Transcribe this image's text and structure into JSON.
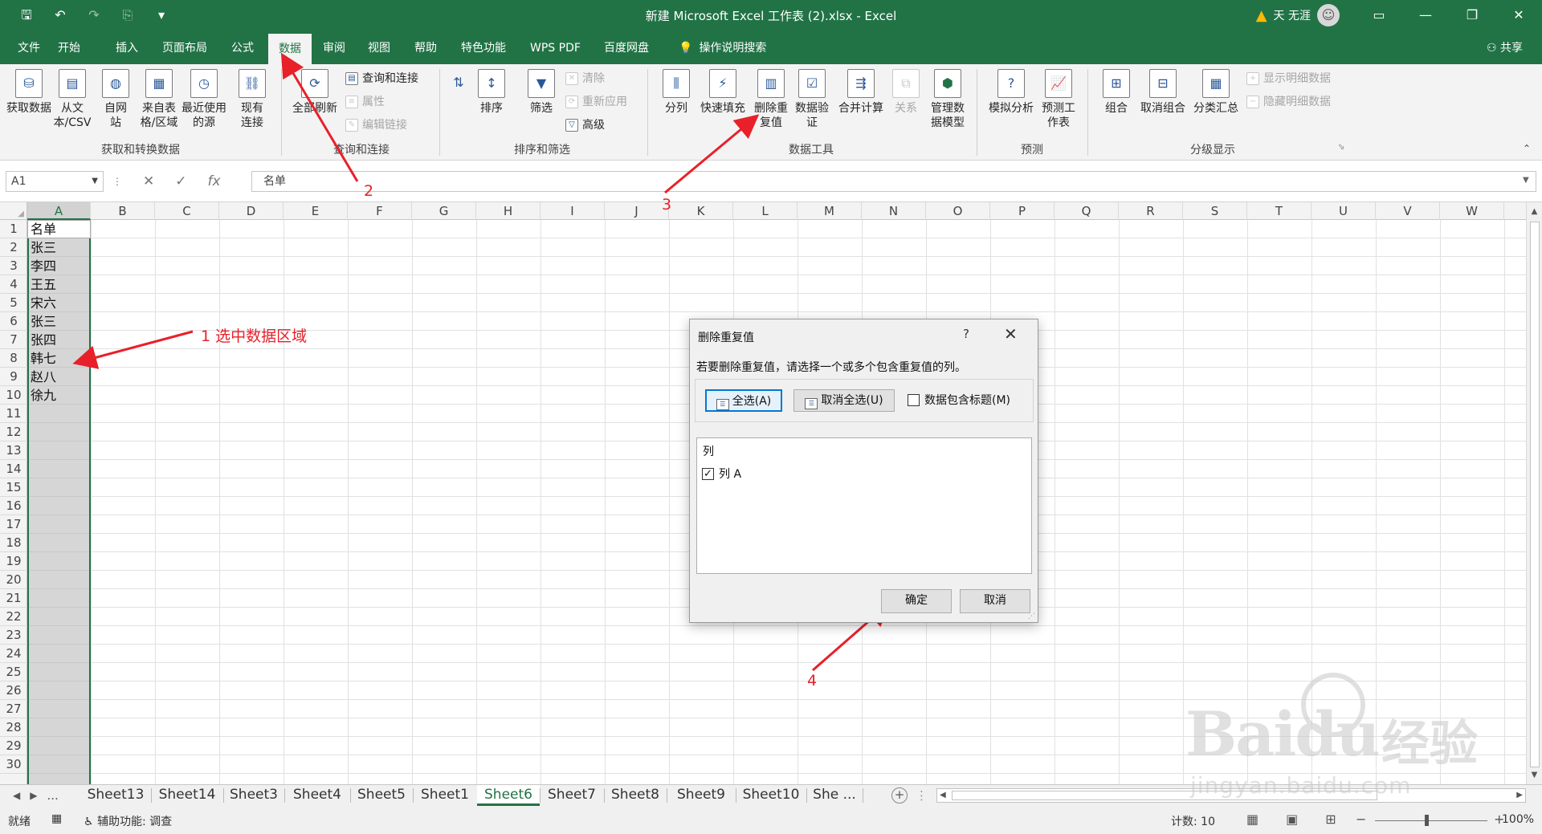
{
  "titlebar": {
    "title": "新建 Microsoft Excel 工作表 (2).xlsx - Excel",
    "user": "天 无涯",
    "save_icon": "save-icon",
    "accent": "#217346"
  },
  "menu_tabs": [
    "文件",
    "开始",
    "插入",
    "页面布局",
    "公式",
    "数据",
    "审阅",
    "视图",
    "帮助",
    "特色功能",
    "WPS PDF",
    "百度网盘"
  ],
  "tell_me": "操作说明搜索",
  "share": "共享",
  "ribbon": {
    "get_data": "获取数据",
    "from_csv": "从文本/CSV",
    "from_web": "自网站",
    "from_table": "来自表格/区域",
    "recent_sources": "最近使用的源",
    "existing_conn": "现有连接",
    "group_get": "获取和转换数据",
    "refresh_all": "全部刷新",
    "queries_conn": "查询和连接",
    "properties": "属性",
    "edit_links": "编辑链接",
    "group_query": "查询和连接",
    "sort": "排序",
    "filter": "筛选",
    "clear": "清除",
    "reapply": "重新应用",
    "advanced": "高级",
    "group_sort": "排序和筛选",
    "text_to_cols": "分列",
    "flash_fill": "快速填充",
    "remove_dup": "删除重复值",
    "data_valid": "数据验证",
    "consolidate": "合并计算",
    "relations": "关系",
    "data_model": "管理数据模型",
    "group_tools": "数据工具",
    "whatif": "模拟分析",
    "forecast": "预测工作表",
    "group_forecast": "预测",
    "group_btn": "组合",
    "ungroup": "取消组合",
    "subtotal": "分类汇总",
    "show_detail": "显示明细数据",
    "hide_detail": "隐藏明细数据",
    "group_outline": "分级显示"
  },
  "formula": {
    "name_box": "A1",
    "content": "名单",
    "fx": "fx"
  },
  "columns": [
    "A",
    "B",
    "C",
    "D",
    "E",
    "F",
    "G",
    "H",
    "I",
    "J",
    "K",
    "L",
    "M",
    "N",
    "O",
    "P",
    "Q",
    "R",
    "S",
    "T",
    "U",
    "V",
    "W"
  ],
  "rows": [
    "1",
    "2",
    "3",
    "4",
    "5",
    "6",
    "7",
    "8",
    "9",
    "10",
    "11",
    "12",
    "13",
    "14",
    "15",
    "16",
    "17",
    "18",
    "19",
    "20",
    "21",
    "22",
    "23",
    "24",
    "25",
    "26",
    "27",
    "28",
    "29",
    "30"
  ],
  "cells_a": [
    "名单",
    "张三",
    "李四",
    "王五",
    "宋六",
    "张三",
    "张四",
    "韩七",
    "赵八",
    "徐九"
  ],
  "annotations": {
    "a1": "1 选中数据区域",
    "a2": "2",
    "a3": "3",
    "a4": "4",
    "color": "#e8202a"
  },
  "dialog": {
    "title": "删除重复值",
    "help": "?",
    "desc": "若要删除重复值，请选择一个或多个包含重复值的列。",
    "select_all": "全选(A)",
    "unselect_all": "取消全选(U)",
    "has_header": "数据包含标题(M)",
    "has_header_checked": false,
    "list_header": "列",
    "columns": [
      {
        "label": "列 A",
        "checked": true
      }
    ],
    "ok": "确定",
    "cancel": "取消"
  },
  "sheets": [
    "Sheet13",
    "Sheet14",
    "Sheet3",
    "Sheet4",
    "Sheet5",
    "Sheet1",
    "Sheet6",
    "Sheet7",
    "Sheet8",
    "Sheet9",
    "Sheet10",
    "She ..."
  ],
  "active_sheet": "Sheet6",
  "sheet_nav_more": "...",
  "status": {
    "ready": "就绪",
    "accessibility": "辅助功能: 调查",
    "count": "计数: 10",
    "zoom": "100%"
  },
  "watermark": {
    "brand": "Baidu",
    "cn": "经验",
    "url": "jingyan.baidu.com"
  }
}
